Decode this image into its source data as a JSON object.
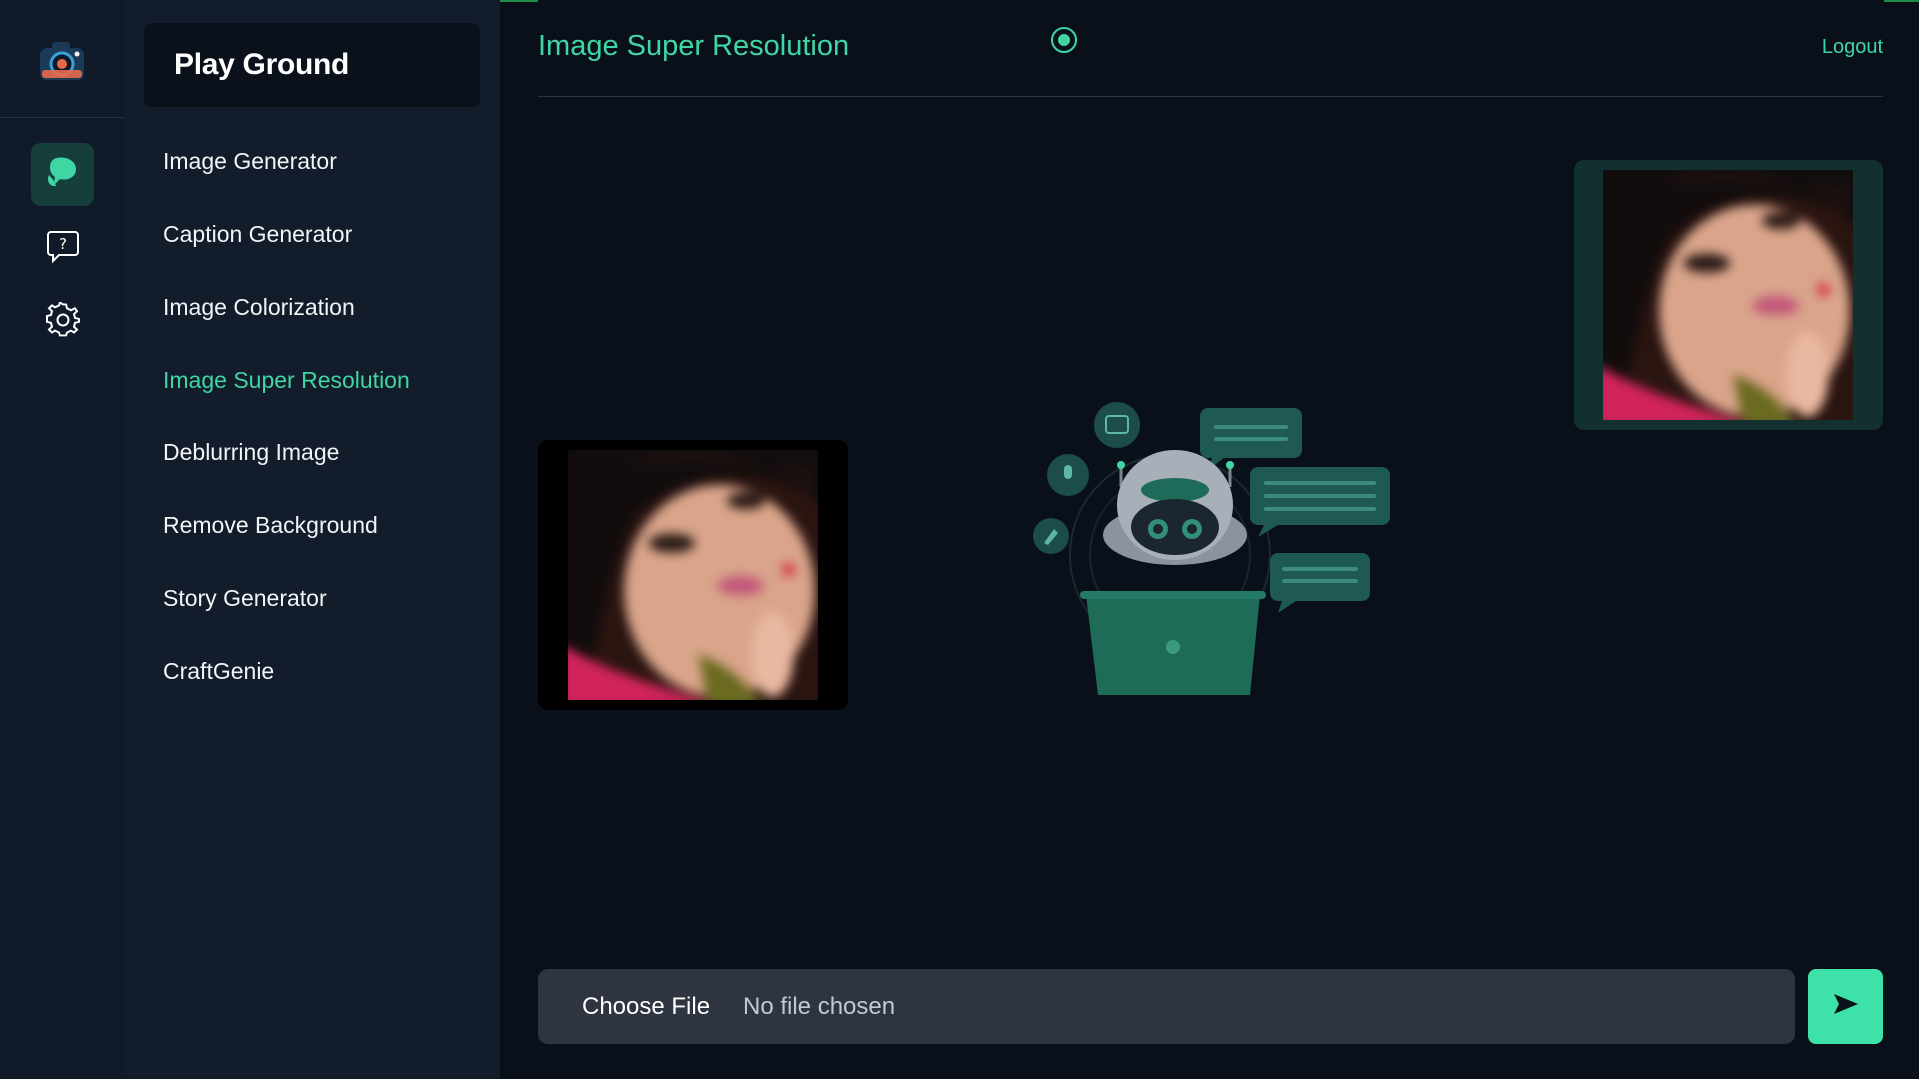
{
  "app": {
    "brand": "Play Ground"
  },
  "rail": {
    "items": [
      {
        "icon": "chat-bubbles-icon",
        "active": true
      },
      {
        "icon": "help-chat-icon",
        "active": false
      },
      {
        "icon": "gear-icon",
        "active": false
      }
    ]
  },
  "sidebar": {
    "items": [
      {
        "label": "Image Generator",
        "active": false
      },
      {
        "label": "Caption Generator",
        "active": false
      },
      {
        "label": "Image Colorization",
        "active": false
      },
      {
        "label": "Image Super Resolution",
        "active": true
      },
      {
        "label": "Deblurring Image",
        "active": false
      },
      {
        "label": "Remove Background",
        "active": false
      },
      {
        "label": "Story Generator",
        "active": false
      },
      {
        "label": "CraftGenie",
        "active": false
      }
    ]
  },
  "header": {
    "title": "Image Super Resolution",
    "logout": "Logout"
  },
  "upload": {
    "choose_label": "Choose File",
    "status": "No file chosen"
  },
  "colors": {
    "accent": "#3fd6a4",
    "background": "#0a101a",
    "panel": "#131c2a",
    "send": "#3ee2a8"
  }
}
